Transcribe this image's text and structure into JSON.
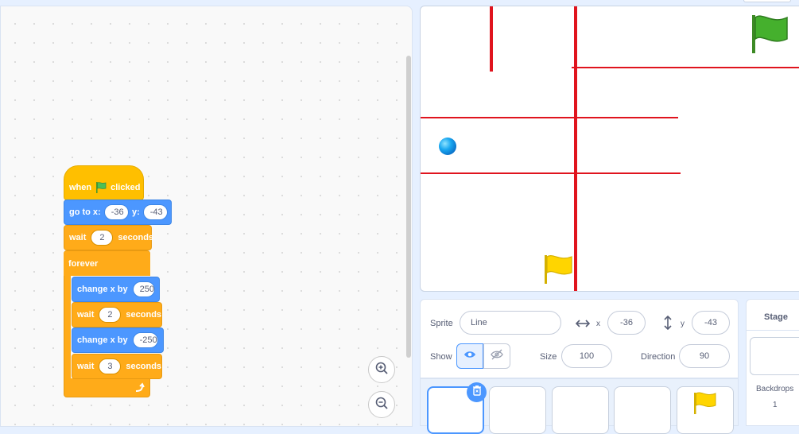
{
  "script": {
    "hat": {
      "when": "when",
      "clicked": "clicked"
    },
    "goto": {
      "label": "go to x:",
      "x": "-36",
      "y_label": "y:",
      "y": "-43"
    },
    "wait1": {
      "label": "wait",
      "value": "2",
      "unit": "seconds"
    },
    "forever": {
      "label": "forever"
    },
    "change1": {
      "label": "change x by",
      "value": "250"
    },
    "wait2": {
      "label": "wait",
      "value": "2",
      "unit": "seconds"
    },
    "change2": {
      "label": "change x by",
      "value": "-250"
    },
    "wait3": {
      "label": "wait",
      "value": "3",
      "unit": "seconds"
    }
  },
  "sprite_info": {
    "sprite_label": "Sprite",
    "sprite_name": "Line",
    "x_label": "x",
    "x_value": "-36",
    "y_label": "y",
    "y_value": "-43",
    "show_label": "Show",
    "size_label": "Size",
    "size_value": "100",
    "direction_label": "Direction",
    "direction_value": "90"
  },
  "stage_panel": {
    "title": "Stage",
    "backdrops_label": "Backdrops",
    "backdrops_count": "1"
  },
  "colors": {
    "events": "#ffbf00",
    "control": "#ffab19",
    "motion": "#4c97ff",
    "stage_line": "#e0141e",
    "accent": "#4c97ff"
  },
  "icons": [
    "green-flag-icon",
    "zoom-in-icon",
    "zoom-out-icon",
    "eye-icon",
    "eye-slash-icon",
    "trash-icon",
    "x-arrows-icon",
    "y-arrows-icon",
    "loop-arrow-icon"
  ]
}
